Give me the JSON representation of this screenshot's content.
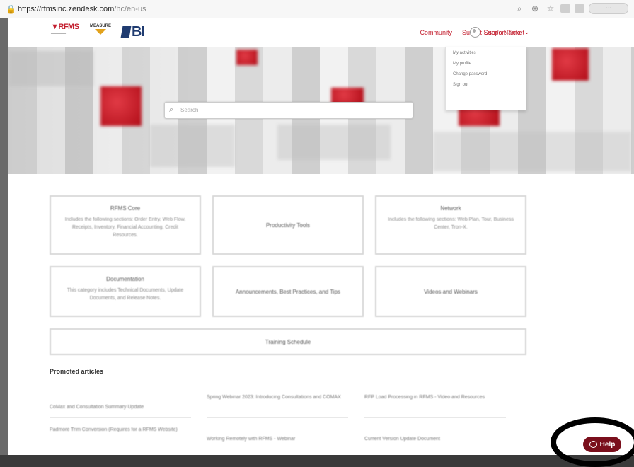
{
  "browser": {
    "url_host": "https://rfmsinc.zendesk.com",
    "url_path": "/hc/en-us",
    "icons": [
      "lock-icon",
      "search-icon",
      "zoom-icon",
      "star-icon"
    ]
  },
  "header": {
    "logo_rfms": "RFMS",
    "logo_measure": "MEASURE",
    "logo_bi": "BI",
    "nav": [
      "Community",
      "Submit Support Ticket"
    ],
    "user_name": "User's Name",
    "user_caret": "⌄"
  },
  "dropdown": {
    "items": [
      "My activities",
      "My profile",
      "Change password",
      "Sign out"
    ]
  },
  "hero": {
    "search_placeholder": "Search"
  },
  "categories": [
    {
      "title": "RFMS Core",
      "desc": "Includes the following sections: Order Entry, Web Flow, Receipts, Inventory, Financial Accounting, Credit Resources."
    },
    {
      "title": "Productivity Tools",
      "desc": ""
    },
    {
      "title": "Network",
      "desc": "Includes the following sections: Web Plan, Tour, Business Center, Tron-X."
    },
    {
      "title": "Documentation",
      "desc": "This category includes Technical Documents, Update Documents, and Release Notes."
    },
    {
      "title": "Announcements, Best Practices, and Tips",
      "desc": ""
    },
    {
      "title": "Videos and Webinars",
      "desc": ""
    },
    {
      "title": "Training Schedule",
      "desc": ""
    }
  ],
  "promoted": {
    "title": "Promoted articles",
    "articles": [
      "CoMax and Consultation Summary Update",
      "Spring Webinar 2023: Introducing Consultations and COMAX",
      "RFP Load Processing in RFMS - Video and Resources",
      "Padmore Trim Conversion (Requires for a RFMS Website)",
      "Working Remotely with RFMS - Webinar",
      "Current Version Update Document"
    ]
  },
  "help": {
    "label": "Help"
  },
  "colors": {
    "brand_red": "#c31e2e",
    "help_bg": "#7a0f1c",
    "bi_blue": "#1f3b70"
  }
}
